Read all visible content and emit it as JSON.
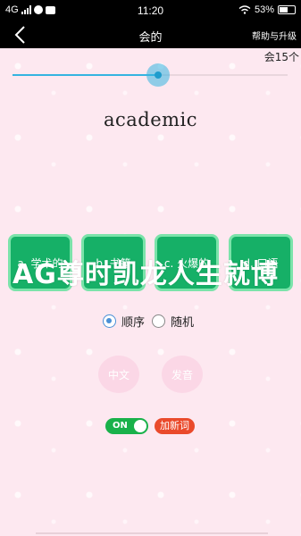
{
  "status": {
    "network": "4G",
    "time": "11:20",
    "battery_pct": "53%"
  },
  "header": {
    "title": "会的",
    "help_label": "帮助与升级"
  },
  "count_label": "会15个",
  "progress": {
    "value": 0.53
  },
  "word": "academic",
  "options": [
    "a. 学术的",
    "b. 书籍",
    "c. 火爆的",
    "d. 口语"
  ],
  "overlay_text": "AG尊时凯龙人生就博",
  "order": {
    "sequential_label": "顺序",
    "random_label": "随机",
    "selected": "sequential"
  },
  "buttons": {
    "chinese_label": "中文",
    "pronounce_label": "发音"
  },
  "toggle": {
    "label": "ON",
    "state": true
  },
  "add_word_label": "加新词",
  "colors": {
    "accent": "#35b4e0",
    "option_bg": "#16b067",
    "toggle_on": "#19b14a",
    "add_word": "#ea4a2b",
    "page_bg": "#fde8f0"
  }
}
